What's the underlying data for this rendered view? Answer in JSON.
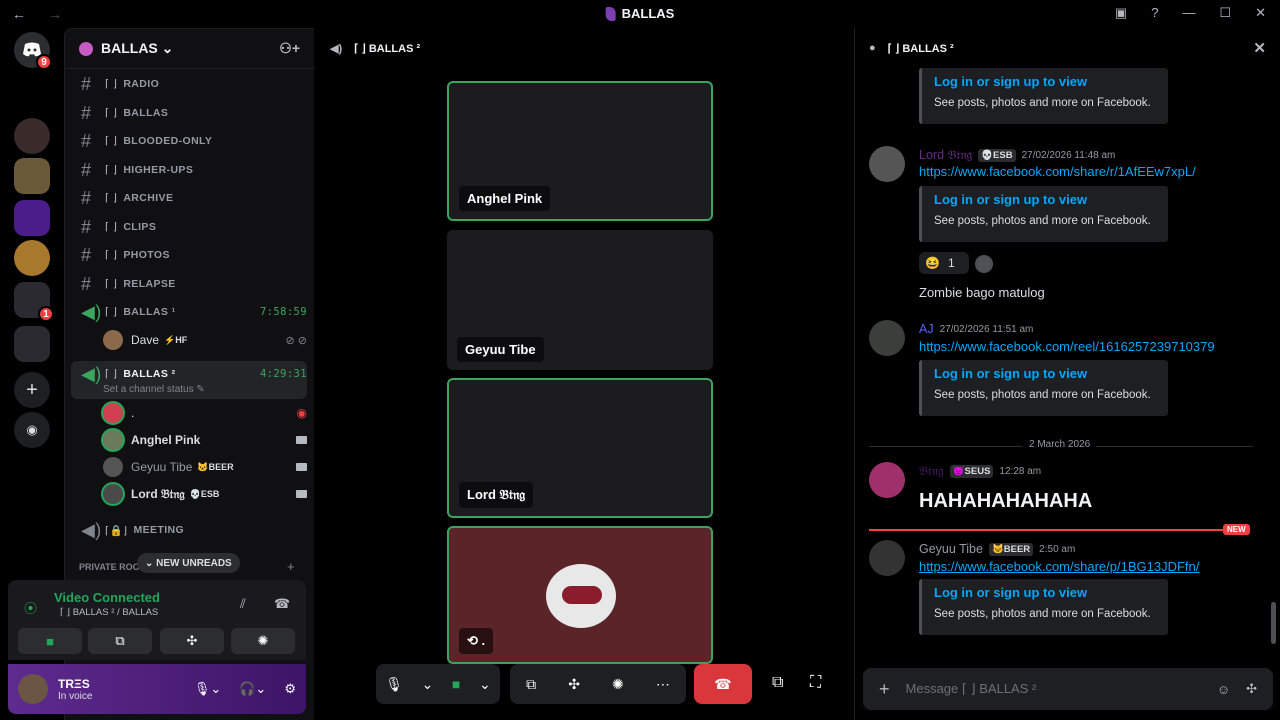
{
  "titlebar": {
    "back": "←",
    "forward": "→",
    "title": "BALLAS",
    "help": "?",
    "minimize": "—",
    "maximize": "☐",
    "close": "✕"
  },
  "server_header": {
    "name": "BALLAS ⌄"
  },
  "channels": [
    {
      "label": "RADIO",
      "bracket": "⌈ ⌋"
    },
    {
      "label": "BALLAS",
      "bracket": "⌈ ⌋"
    },
    {
      "label": "BLOODED-ONLY",
      "bracket": "⌈ ⌋"
    },
    {
      "label": "HIGHER-UPS",
      "bracket": "⌈ ⌋"
    },
    {
      "label": "ARCHIVE",
      "bracket": "⌈ ⌋"
    },
    {
      "label": "CLIPS",
      "bracket": "⌈ ⌋"
    },
    {
      "label": "PHOTOS",
      "bracket": "⌈ ⌋"
    },
    {
      "label": "RELAPSE",
      "bracket": "⌈ ⌋"
    }
  ],
  "voice1": {
    "label": "BALLAS ¹",
    "time": "7:58:59",
    "user": "Dave",
    "tag": "⚡HF"
  },
  "voice2": {
    "label": "BALLAS ²",
    "time": "4:29:31",
    "status": "Set a channel status ✎",
    "users": [
      {
        "name": ".",
        "tag": ""
      },
      {
        "name": "Anghel Pink",
        "tag": ""
      },
      {
        "name": "Geyuu Tibe",
        "tag": "🐱BEER"
      },
      {
        "name": "Lord 𝔅𝔱𝔫𝔤",
        "tag": "💀ESB"
      }
    ]
  },
  "meeting": {
    "label": "MEETING"
  },
  "private": {
    "label": "PRIVATE ROO",
    "unreads": "⌄ NEW UNREADS"
  },
  "voice_panel": {
    "status": "Video Connected",
    "channel": "⌈ ⌋ BALLAS ² / BALLAS"
  },
  "user_panel": {
    "name": "TRΞS",
    "status": "In voice"
  },
  "stage": {
    "header": "⌈ ⌋ BALLAS ²",
    "tiles": [
      "Anghel Pink",
      "Geyuu Tibe",
      "Lord 𝔅𝔱𝔫𝔤",
      "."
    ]
  },
  "chat": {
    "header": "⌈ ⌋ BALLAS ²",
    "embed_link": "Log in or sign up to view",
    "embed_text": "See posts, photos and more on Facebook.",
    "msg1": {
      "author": "Lord 𝔅𝔱𝔫𝔤",
      "tag": "💀ESB",
      "time": "27/02/2026 11:48 am",
      "link": "https://www.facebook.com/share/r/1AfEEw7xpL/",
      "reaction_count": "1",
      "text": "Zombie bago matulog"
    },
    "msg2": {
      "author": "AJ",
      "time": "27/02/2026 11:51 am",
      "link": "https://www.facebook.com/reel/1616257239710379"
    },
    "divider": "2 March 2026",
    "msg3": {
      "author": "𝔅𝔱𝔫𝔤",
      "tag": "😈SEUS",
      "time": "12:28 am",
      "text": "HAHAHAHAHAHA"
    },
    "new": "NEW",
    "msg4": {
      "author": "Geyuu Tibe",
      "tag": "🐱BEER",
      "time": "2:50 am",
      "link": "https://www.facebook.com/share/p/1BG13JDFfn/"
    },
    "placeholder": "Message ⌈ ⌋ BALLAS ²"
  },
  "colors": {
    "green": "#3ba55d",
    "purple": "#5e2b8e",
    "red": "#da373c",
    "link": "#00a8fc"
  },
  "server_badge": "9",
  "server_badge2": "1"
}
